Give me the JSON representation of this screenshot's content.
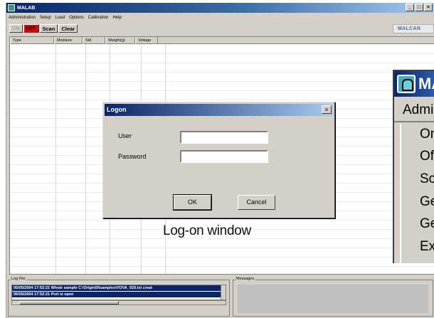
{
  "app": {
    "title": "MALAB",
    "window_buttons": [
      "_",
      "□",
      "×"
    ],
    "brand": "MALCAN"
  },
  "menu": [
    "Administration",
    "Setup",
    "Load",
    "Options",
    "Calibration",
    "Help"
  ],
  "toolbar": {
    "on_label": "ON",
    "off_label": "OFF",
    "scan_label": "Scan",
    "clear_label": "Clear"
  },
  "grid": {
    "columns": [
      "Type",
      "Moisture",
      "Std",
      "Weight(g)",
      "Voltage"
    ]
  },
  "dialog": {
    "title": "Logon",
    "close_label": "×",
    "user_label": "User",
    "password_label": "Password",
    "user_value": "",
    "password_value": "",
    "ok_label": "OK",
    "cancel_label": "Cancel"
  },
  "caption": "Log-on window",
  "zoomed_menu": {
    "title": "MA",
    "menubar_label": "Admi",
    "items": [
      "On",
      "Of",
      "Sc",
      "Ge",
      "Ge",
      "Ex"
    ]
  },
  "log": {
    "label": "Log File",
    "lines": [
      "05/05/2004 17:52:21 Whole sample C:\\Origin5f\\samples\\VOVA_029.txt creat",
      "05/05/2004 17:52:21 Port is open"
    ]
  },
  "messages": {
    "label": "Messages"
  },
  "colors": {
    "titlebar_start": "#0a246a",
    "off_button": "#e00000",
    "window_bg": "#d4d0c8"
  }
}
